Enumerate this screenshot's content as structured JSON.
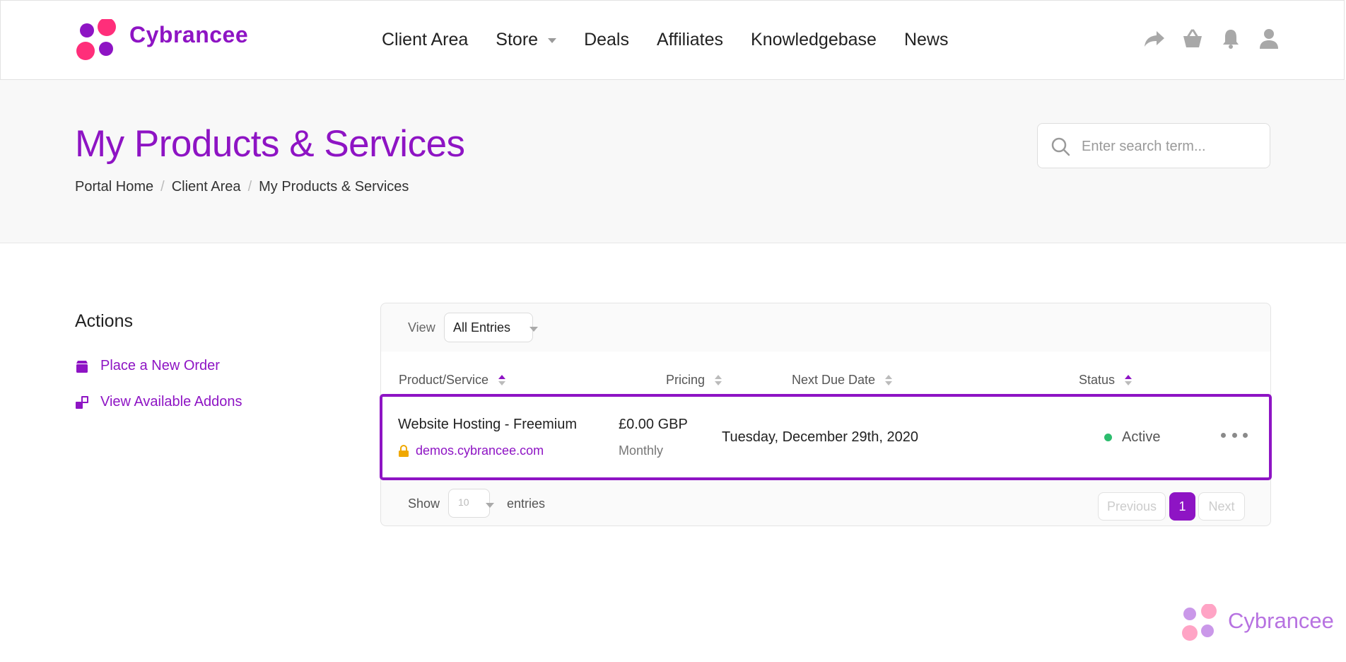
{
  "brand": {
    "name": "Cybrancee",
    "color": "#8e14c4",
    "dot_colors": [
      "#8e14c4",
      "#ff2e7a"
    ]
  },
  "nav": {
    "items": [
      {
        "label": "Client Area"
      },
      {
        "label": "Store",
        "has_dropdown": true
      },
      {
        "label": "Deals"
      },
      {
        "label": "Affiliates"
      },
      {
        "label": "Knowledgebase"
      },
      {
        "label": "News"
      }
    ],
    "icons": [
      "share-icon",
      "basket-icon",
      "bell-icon",
      "user-icon"
    ]
  },
  "page": {
    "title": "My Products & Services",
    "breadcrumb": [
      "Portal Home",
      "Client Area",
      "My Products & Services"
    ]
  },
  "search": {
    "placeholder": "Enter search term...",
    "value": ""
  },
  "sidebar": {
    "title": "Actions",
    "items": [
      {
        "label": "Place a New Order",
        "icon": "box-icon"
      },
      {
        "label": "View Available Addons",
        "icon": "addons-icon"
      }
    ]
  },
  "table": {
    "view_label": "View",
    "view_value": "All Entries",
    "columns": [
      "Product/Service",
      "Pricing",
      "Next Due Date",
      "Status"
    ],
    "rows": [
      {
        "product": "Website Hosting - Freemium",
        "domain": "demos.cybrancee.com",
        "price": "£0.00 GBP",
        "cycle": "Monthly",
        "due": "Tuesday, December 29th, 2020",
        "status": "Active",
        "status_color": "#2dbd6e"
      }
    ],
    "show_label": "Show",
    "entries_value": "10",
    "entries_label": "entries",
    "pagination": {
      "previous": "Previous",
      "current": "1",
      "next": "Next"
    }
  },
  "watermark": {
    "text": "Cybrancee"
  }
}
